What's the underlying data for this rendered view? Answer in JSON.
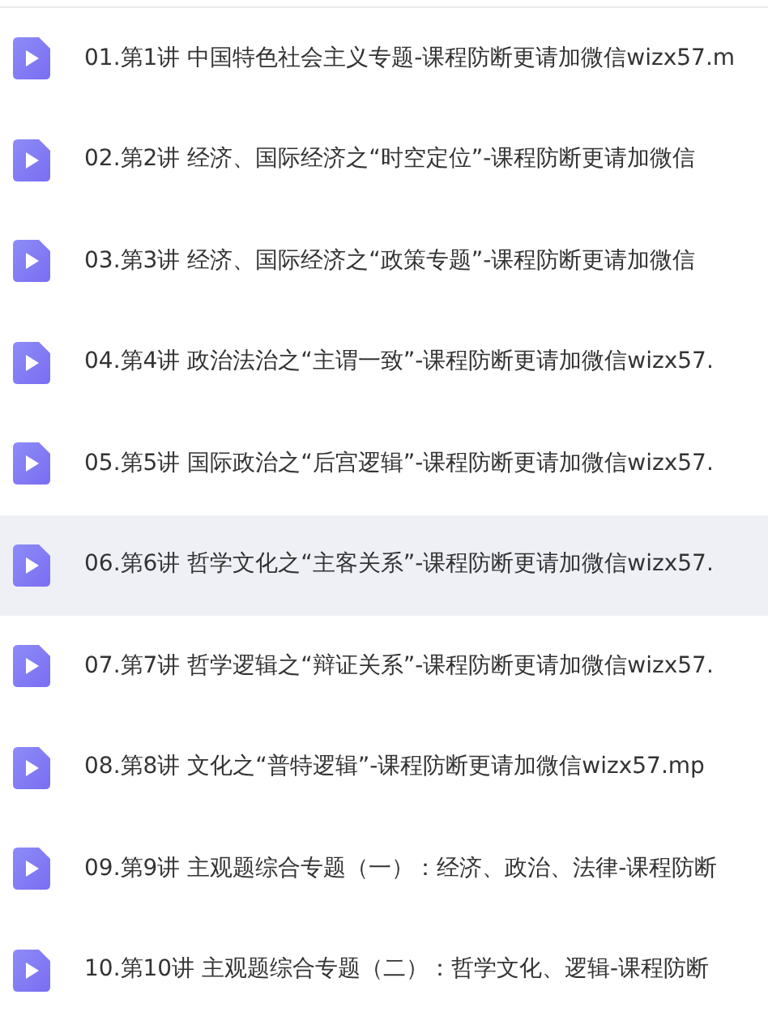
{
  "files": [
    {
      "name": "01.第1讲 中国特色社会主义专题-课程防断更请加微信wizx57.m",
      "selected": false
    },
    {
      "name": "02.第2讲 经济、国际经济之“时空定位”-课程防断更请加微信",
      "selected": false
    },
    {
      "name": "03.第3讲 经济、国际经济之“政策专题”-课程防断更请加微信",
      "selected": false
    },
    {
      "name": "04.第4讲 政治法治之“主谓一致”-课程防断更请加微信wizx57.",
      "selected": false
    },
    {
      "name": "05.第5讲 国际政治之“后宫逻辑”-课程防断更请加微信wizx57.",
      "selected": false
    },
    {
      "name": "06.第6讲 哲学文化之“主客关系”-课程防断更请加微信wizx57.",
      "selected": true
    },
    {
      "name": "07.第7讲 哲学逻辑之“辩证关系”-课程防断更请加微信wizx57.",
      "selected": false
    },
    {
      "name": "08.第8讲 文化之“普特逻辑”-课程防断更请加微信wizx57.mp",
      "selected": false
    },
    {
      "name": "09.第9讲 主观题综合专题（一）：经济、政治、法律-课程防断",
      "selected": false
    },
    {
      "name": "10.第10讲 主观题综合专题（二）：哲学文化、逻辑-课程防断",
      "selected": false
    }
  ]
}
